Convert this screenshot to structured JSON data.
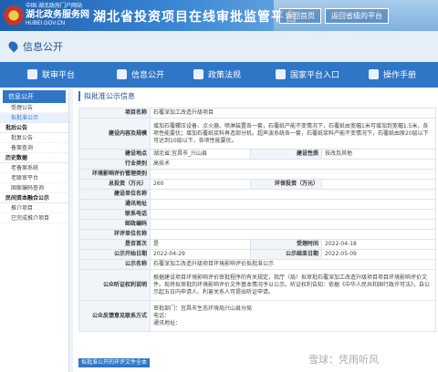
{
  "header": {
    "logo_small_line1": "中国·湖北政府门户网站",
    "logo_small_line2": "HUBEI.GOV.CN",
    "logo_big": "湖北政务服务网",
    "title": "湖北省投资项目在线审批监管平台",
    "btn_home": "返回首页",
    "btn_province": "返回省级的平台"
  },
  "subbar": {
    "location": "信息公开"
  },
  "nav": {
    "items": [
      {
        "label": "联审平台"
      },
      {
        "label": "信息公开"
      },
      {
        "label": "政策法规"
      },
      {
        "label": "国家平台入口"
      },
      {
        "label": "操作手册"
      }
    ]
  },
  "sidebar": {
    "header": "信息公开",
    "groups": [
      {
        "type": "item",
        "label": "受理公告"
      },
      {
        "type": "item",
        "label": "拟批准公示",
        "active": true
      },
      {
        "type": "group",
        "label": "批后公告"
      },
      {
        "type": "item",
        "label": "批复公告"
      },
      {
        "type": "item",
        "label": "备案查询"
      },
      {
        "type": "group",
        "label": "历史数据"
      },
      {
        "type": "item",
        "label": "老备案系统"
      },
      {
        "type": "item",
        "label": "老联审平台"
      },
      {
        "type": "item",
        "label": "国家编码查询"
      },
      {
        "type": "group",
        "label": "民间资本融合公示"
      },
      {
        "type": "item",
        "label": "推介项目"
      },
      {
        "type": "item",
        "label": "已完成推介项目"
      }
    ]
  },
  "main": {
    "title": "拟批准公示信息",
    "rows": {
      "project_name_k": "项目名称",
      "project_name_v": "石覆深加工改造升级项目",
      "content_k": "建设内容及规模",
      "content_v": "增加石覆螺压设备、点火器、喷淋装置各一套，石覆纸产能不变情况下，石覆纸由宽幅1米可增加到宽幅1.5米，各项性能要优；增加石覆纸浆料再造部分机。超声波系统各一套，石覆纸浆料产能不变情况下，石覆纸由原20层以下可达到10层以下，各项性能要优。",
      "site_k": "建设地点",
      "site_v": "湖北省;宜昌市_兴山县",
      "nature_k": "建设性质",
      "nature_v": "技改及其他",
      "industry_k": "行业类别",
      "industry_v": "高技术",
      "env_k": "环境影响评价管理类别",
      "env_v": "",
      "invest_k": "总投资（万元）",
      "invest_v": "260",
      "env_invest_k": "环保投资（万元）",
      "env_invest_v": "",
      "unit_k": "建设单位名称",
      "address_k": "通讯地址",
      "contact_k": "联系电话",
      "postcode_k": "邮政编码",
      "eia_k": "环评单位名称",
      "first_k": "是否首次",
      "first_v": "是",
      "accept_time_k": "受理时间",
      "accept_time_v": "2022-04-18",
      "start_k": "公示开始日期",
      "start_v": "2022-04-29",
      "end_k": "公示结束日期",
      "end_v": "2022-05-09",
      "pub_name_k": "公示名称",
      "pub_name_v": "石覆深加工改造升级项目环境影响评价拟批准公示",
      "hearing_k": "公众听证权利说明",
      "hearing_v": "根据建设项目环境影响评价审批程序的有关规定，我厅（局）拟审批石覆深加工改造升级项目项目环境影响评价文件。现将拟审批的环境影响评价文件基本情况予以公示。听证权利告知：依据《中华人民共和国行政许可法》，自公示起五日内申请人、利害关系人可提出听证申请。",
      "feedback_k": "公众反馈意见联系方式",
      "feedback_v1": "审批部门：宜昌市生态环境局兴山县分局",
      "feedback_v2": "电话：",
      "feedback_v3": "通讯地址："
    },
    "highlight": "拟批准公开的环评文件全本"
  },
  "watermark": "雪球：凭雨听风"
}
